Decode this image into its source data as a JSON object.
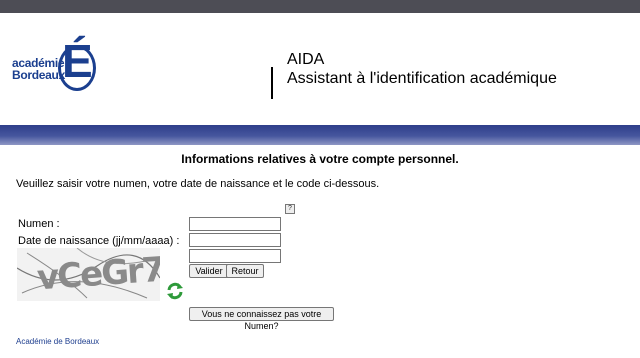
{
  "header": {
    "logo_line1": "académie",
    "logo_line2": "Bordeaux",
    "logo_letter": "É",
    "app_name": "AIDA",
    "app_subtitle": "Assistant à l'identification académique"
  },
  "main": {
    "section_title": "Informations relatives à votre compte personnel.",
    "instructions": "Veuillez saisir votre numen, votre date de naissance et le code ci-dessous.",
    "help_icon": "?",
    "form": {
      "numen_label": "Numen :",
      "numen_value": "",
      "birthdate_label": "Date de naissance (jj/mm/aaaa) :",
      "birthdate_value": "",
      "captcha_value": "",
      "captcha_text": "vCeGr7",
      "validate_label": "Valider",
      "back_label": "Retour",
      "forgot_numen_label": "Vous ne connaissez pas votre Numen?"
    }
  },
  "footer": {
    "link": "Académie de Bordeaux"
  },
  "icons": {
    "refresh": "refresh-icon",
    "help": "help-icon"
  },
  "colors": {
    "brand": "#1b3f8f",
    "band": "#46569e",
    "topbar": "#4d4d55"
  }
}
